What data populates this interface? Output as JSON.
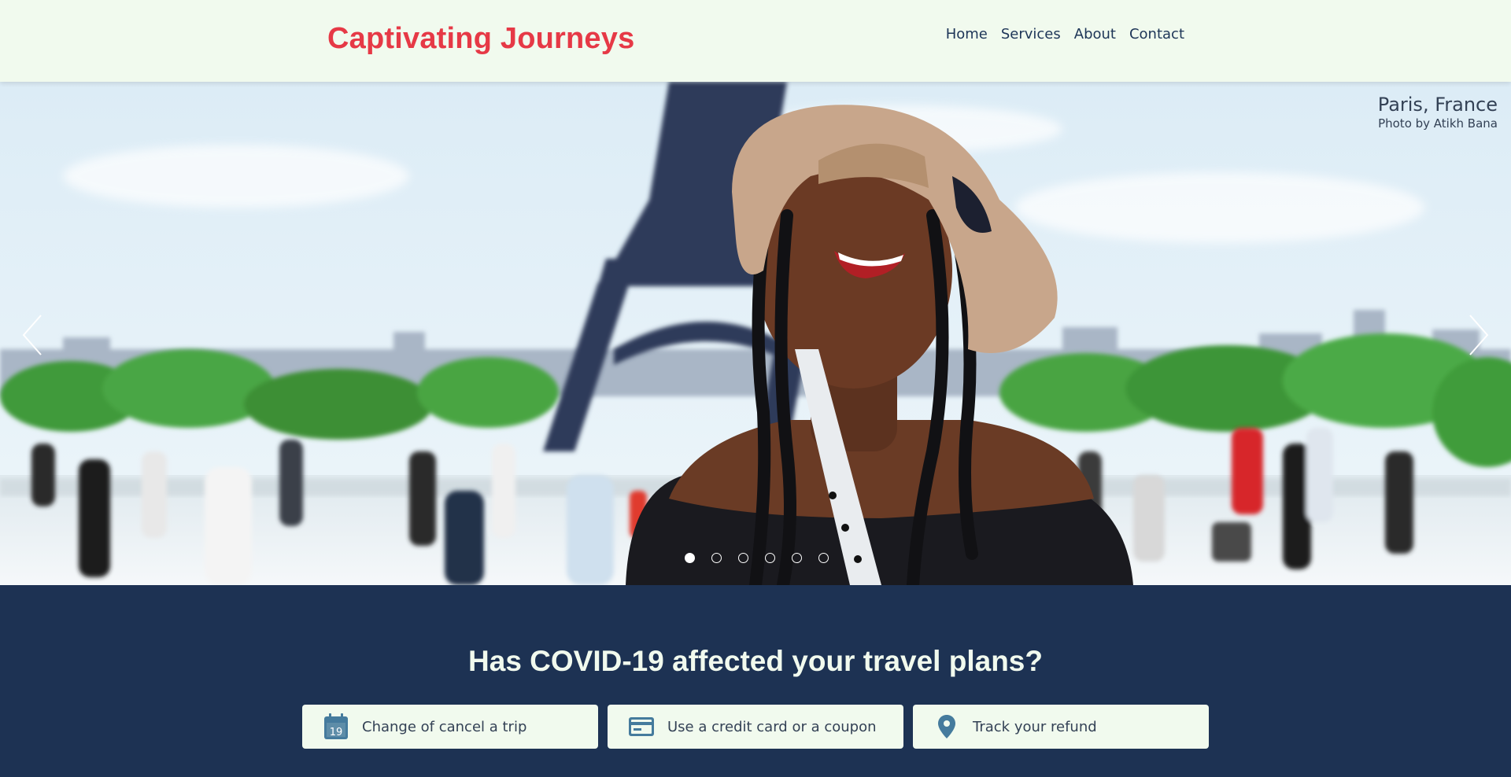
{
  "header": {
    "brand": "Captivating Journeys",
    "nav": [
      "Home",
      "Services",
      "About",
      "Contact"
    ]
  },
  "hero": {
    "caption_place": "Paris, France",
    "caption_credit": "Photo by Atikh Bana",
    "slide_count": 6,
    "active_slide": 1,
    "prev_icon": "chevron-left-icon",
    "next_icon": "chevron-right-icon"
  },
  "covid": {
    "title": "Has COVID-19 affected your travel plans?",
    "cards": [
      {
        "label": "Change of cancel a trip",
        "icon": "calendar-icon",
        "icon_text": "19"
      },
      {
        "label": "Use a credit card or a coupon",
        "icon": "credit-card-icon"
      },
      {
        "label": "Track your refund",
        "icon": "location-pin-icon"
      }
    ]
  },
  "colors": {
    "brand_red": "#e63946",
    "header_bg": "#f1faee",
    "navy": "#1d3253",
    "icon_blue": "#457b9d"
  }
}
